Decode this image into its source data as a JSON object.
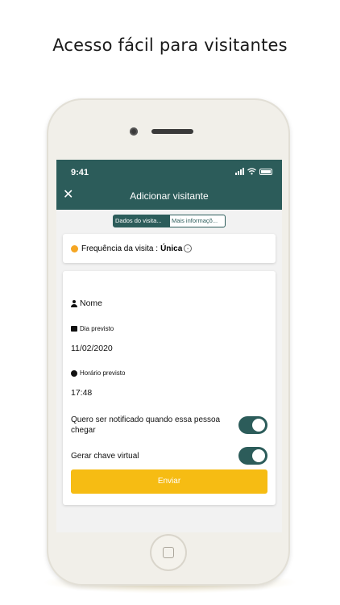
{
  "headline": "Acesso fácil para visitantes",
  "status_bar": {
    "time": "9:41"
  },
  "nav": {
    "title": "Adicionar visitante"
  },
  "tabs": [
    {
      "label": "Dados do visita...",
      "active": true
    },
    {
      "label": "Mais informaçõ...",
      "active": false
    }
  ],
  "frequency": {
    "label": "Frequência da visita :",
    "value": "Única"
  },
  "form": {
    "name_label": "Nome",
    "date_label": "Dia previsto",
    "date_value": "11/02/2020",
    "time_label": "Horário previsto",
    "time_value": "17:48",
    "notify_label": "Quero ser notificado quando essa pessoa chegar",
    "notify_on": true,
    "virtual_key_label": "Gerar chave virtual",
    "virtual_key_on": true,
    "submit_label": "Enviar"
  },
  "colors": {
    "primary": "#2c5c5a",
    "accent": "#f6bc13",
    "dot": "#f5a623"
  }
}
